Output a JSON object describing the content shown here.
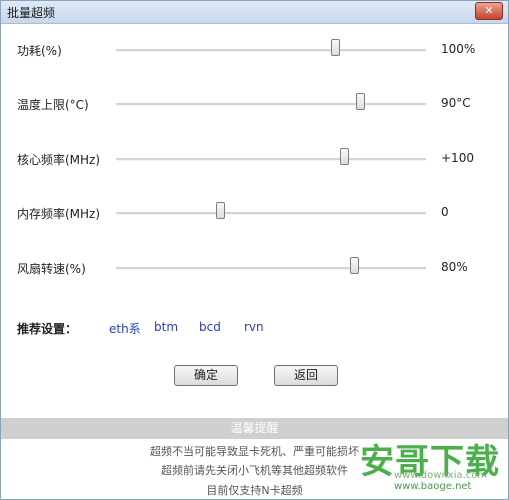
{
  "window": {
    "title": "批量超频",
    "close_glyph": "✕"
  },
  "sliders": [
    {
      "label": "功耗(%)",
      "value": "100%",
      "level": 0.71
    },
    {
      "label": "温度上限(°C)",
      "value": "90°C",
      "level": 0.79
    },
    {
      "label": "核心频率(MHz)",
      "value": "+100",
      "level": 0.74
    },
    {
      "label": "内存频率(MHz)",
      "value": "0",
      "level": 0.34
    },
    {
      "label": "风扇转速(%)",
      "value": "80%",
      "level": 0.77
    }
  ],
  "recommend": {
    "label": "推荐设置：",
    "presets": [
      "eth系",
      "btm",
      "bcd",
      "rvn"
    ]
  },
  "buttons": {
    "ok": "确定",
    "back": "返回"
  },
  "tips": {
    "header": "温馨提醒",
    "lines": [
      "超频不当可能导致显卡死机、严重可能损坏",
      "超频前请先关闭小飞机等其他超频软件",
      "目前仅支持N卡超频"
    ]
  },
  "watermark": {
    "logo_text": "安哥下载",
    "url1": "www.downxia.com",
    "url2": "www.baoge.net"
  },
  "colors": {
    "link": "#2540c8",
    "tips_header_bg": "#cfcfcf",
    "watermark": "#4bb04b"
  }
}
